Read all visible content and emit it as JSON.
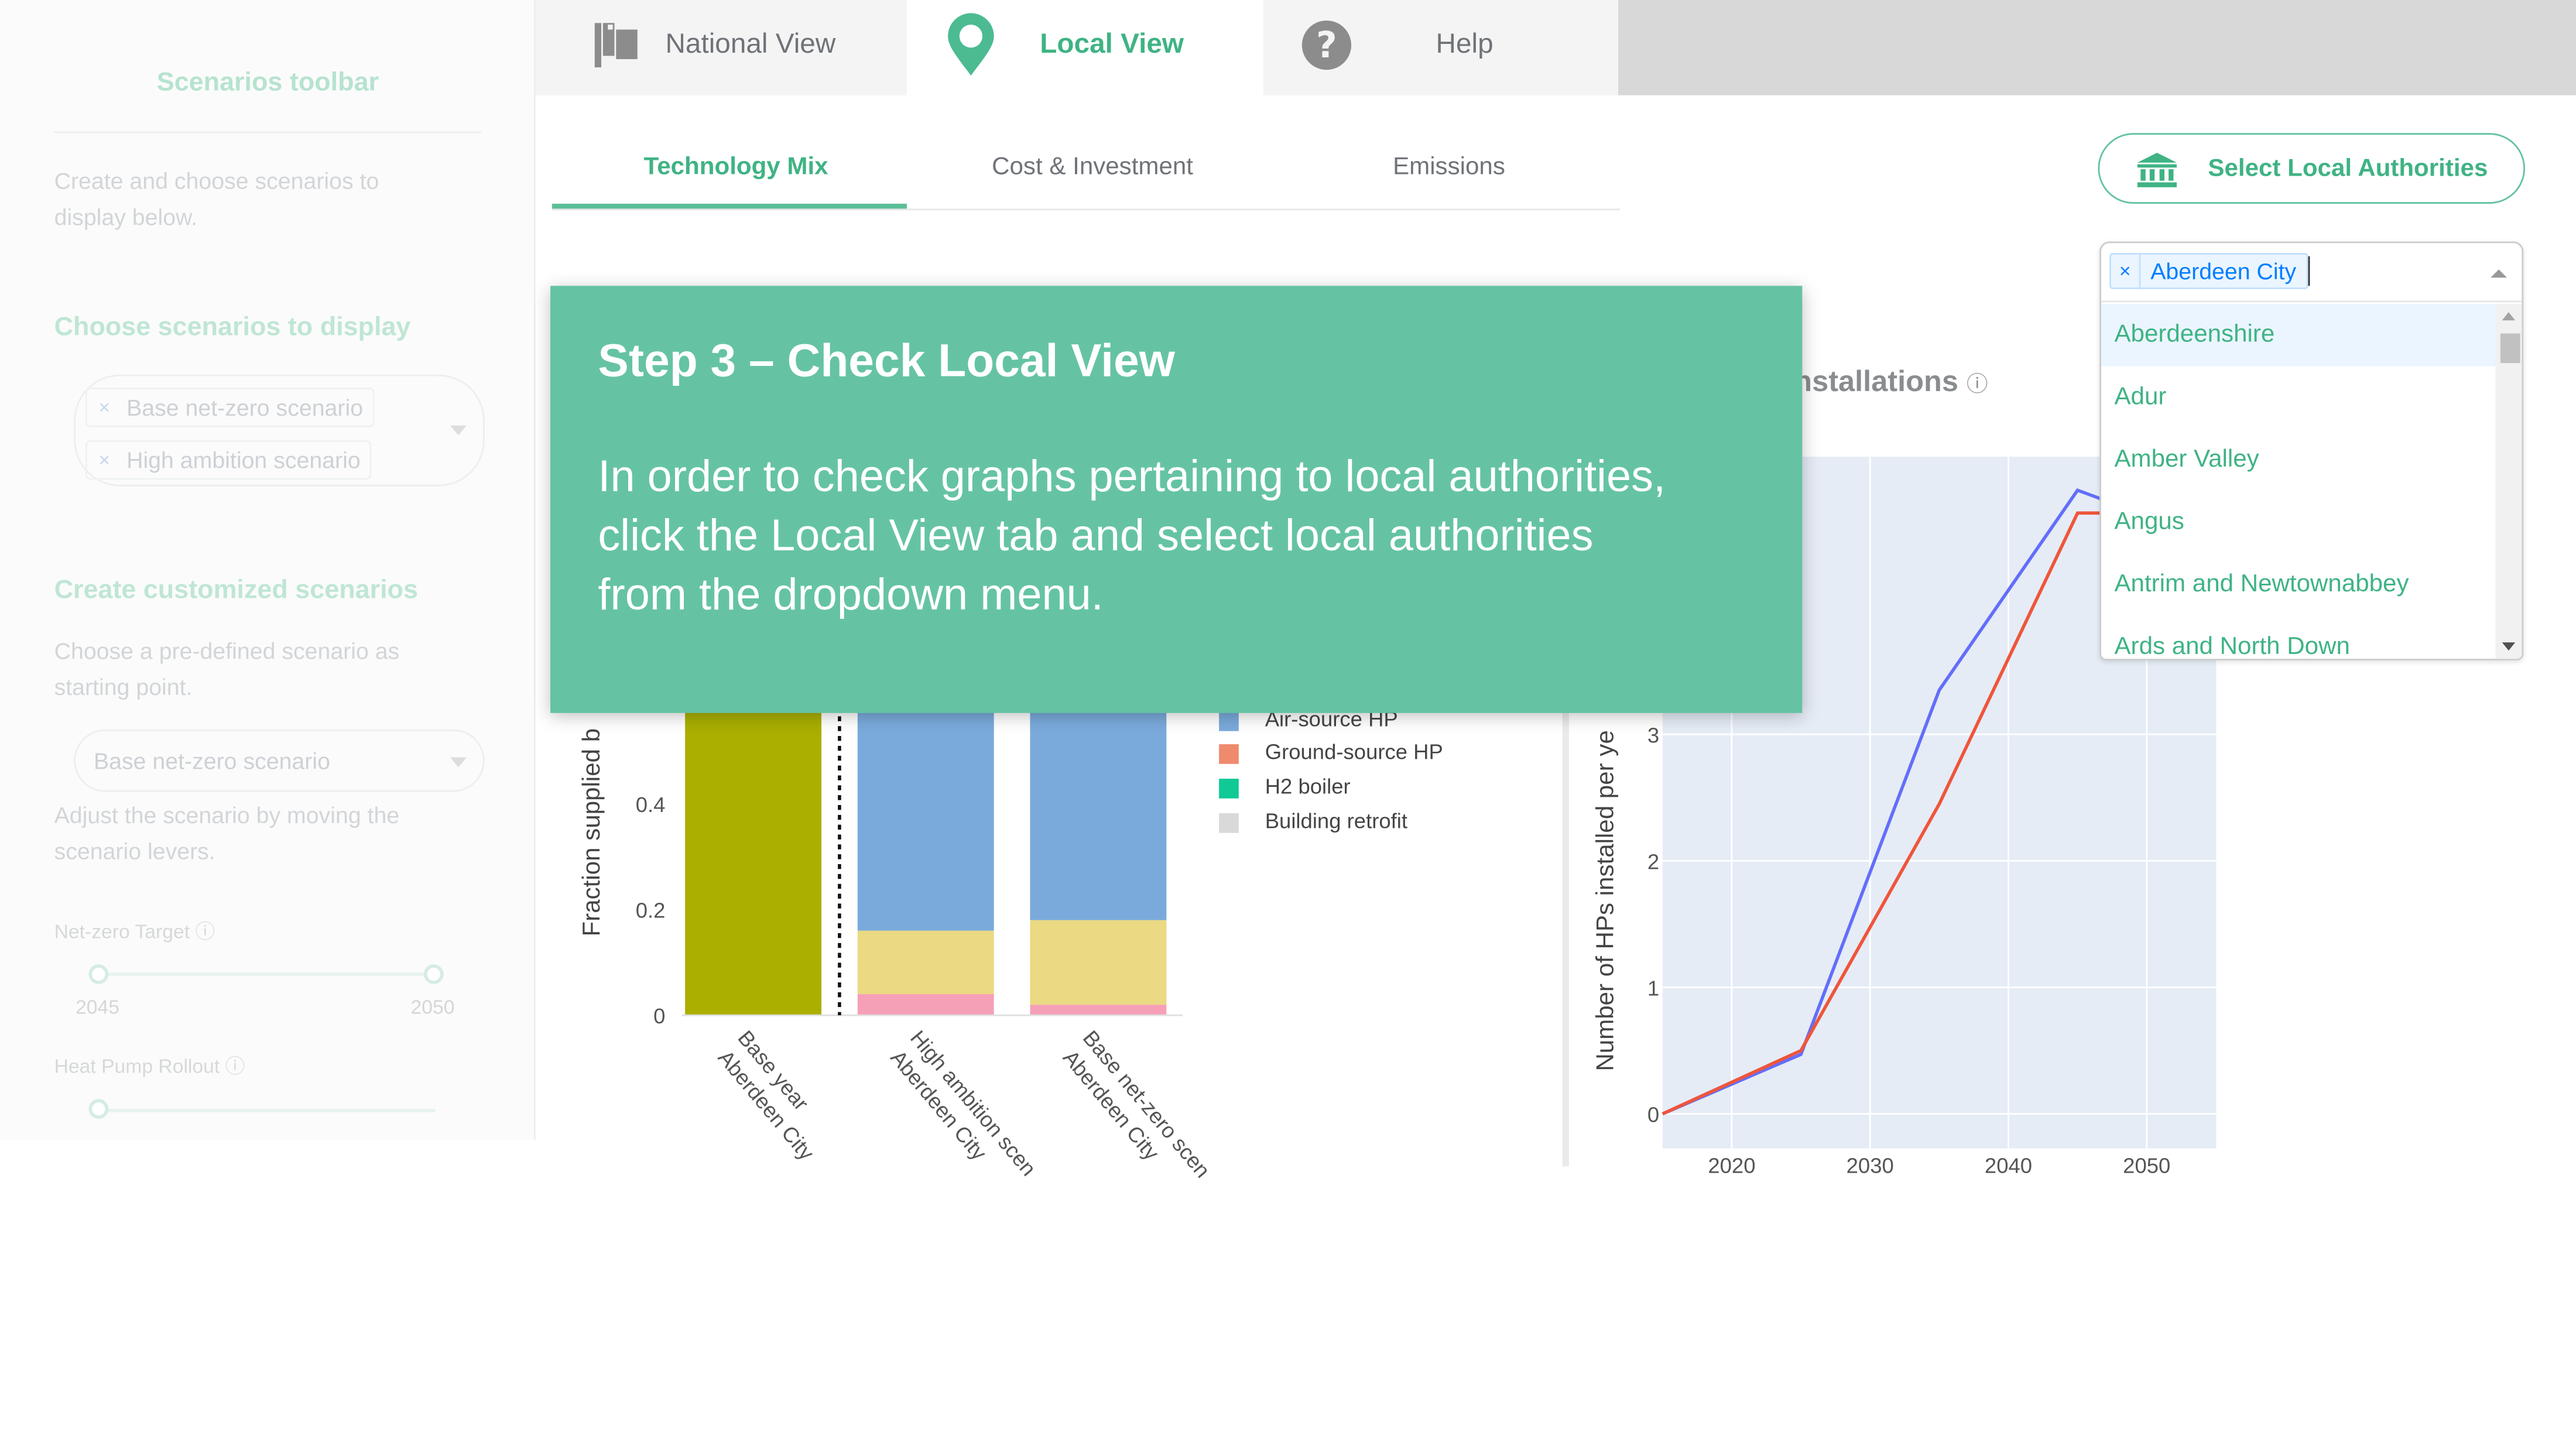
{
  "sidebar": {
    "title": "Scenarios toolbar",
    "intro": "Create and choose scenarios to display below.",
    "choose_heading": "Choose scenarios to display",
    "selected_scenarios": [
      "Base net-zero scenario",
      "High ambition scenario"
    ],
    "create_heading": "Create customized scenarios",
    "create_hint": "Choose a pre-defined scenario as starting point.",
    "predefined_value": "Base net-zero scenario",
    "adjust_hint": "Adjust the scenario by moving the scenario levers.",
    "netzero_label": "Net-zero Target",
    "netzero_min": "2045",
    "netzero_max": "2050",
    "heatpump_label": "Heat Pump Rollout"
  },
  "nav": {
    "tabs": [
      {
        "label": "National View",
        "icon": "flag-icon"
      },
      {
        "label": "Local View",
        "icon": "map-pin-icon"
      },
      {
        "label": "Help",
        "icon": "question-circle-icon"
      }
    ],
    "active_tab": "Local View"
  },
  "subtabs": {
    "items": [
      "Technology Mix",
      "Cost & Investment",
      "Emissions"
    ],
    "active": "Technology Mix"
  },
  "select_button": {
    "label": "Select Local Authorities",
    "icon": "bank-icon"
  },
  "dropdown": {
    "selected": [
      "Aberdeen City"
    ],
    "options": [
      "Aberdeenshire",
      "Adur",
      "Amber Valley",
      "Angus",
      "Antrim and Newtownabbey",
      "Ards and North Down"
    ],
    "focused_option": "Aberdeenshire"
  },
  "tutorial": {
    "title": "Step 3 – Check Local View",
    "body": "In order to check graphs pertaining to local authorities,\nclick the Local View tab and select local authorities\nfrom the dropdown menu."
  },
  "colors": {
    "accent": "#3fb384",
    "card": "#65c3a3",
    "olive": "#aaaf00",
    "air_source": "#7aaadb",
    "ground_source": "#ef8a6d",
    "h2_boiler": "#11c995",
    "retrofit": "#d9d9d9",
    "yellow": "#ebd983",
    "pink": "#f6a0b8",
    "line_blue": "#636efa",
    "line_red": "#ef553b",
    "plot_bg": "#e5ecf6"
  },
  "right_chart_title_fragment": "nstallations",
  "chart_data": [
    {
      "type": "bar",
      "ylabel": "Fraction supplied b",
      "yticks": [
        "0",
        "0.2",
        "0.4"
      ],
      "categories": [
        "Base year\nAberdeen City",
        "High ambition scen\nAberdeen City",
        "Base net-zero scen\nAberdeen City"
      ],
      "legend": [
        "Air-source HP",
        "Ground-source HP",
        "H2 boiler",
        "Building retrofit"
      ],
      "series": [
        {
          "name": "",
          "color": "#aaaf00",
          "values": [
            1.0,
            0.0,
            0.0
          ]
        },
        {
          "name": "",
          "color": "#f6a0b8",
          "values": [
            0.0,
            0.04,
            0.02
          ]
        },
        {
          "name": "",
          "color": "#ebd983",
          "values": [
            0.0,
            0.12,
            0.16
          ]
        },
        {
          "name": "Air-source HP",
          "color": "#7aaadb",
          "values": [
            0.0,
            0.84,
            0.82
          ]
        }
      ],
      "ylim": [
        0,
        0.7
      ]
    },
    {
      "type": "line",
      "ylabel": "Number of HPs installed per ye",
      "x": [
        2015,
        2025,
        2035,
        2045,
        2047
      ],
      "yticks": [
        "0",
        "1",
        "2",
        "3"
      ],
      "xticks": [
        "2020",
        "2030",
        "2040",
        "2050"
      ],
      "series": [
        {
          "name": "",
          "color": "#636efa",
          "values": [
            0,
            0.47,
            3.35,
            4.93,
            4.85
          ]
        },
        {
          "name": "",
          "color": "#ef553b",
          "values": [
            0,
            0.5,
            2.45,
            4.75,
            4.75
          ]
        }
      ]
    }
  ]
}
